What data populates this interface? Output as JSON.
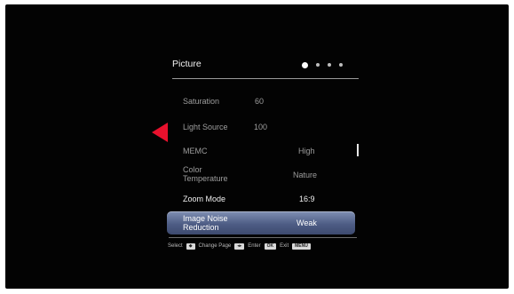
{
  "menu": {
    "title": "Picture",
    "page_dots": [
      {
        "active": true
      },
      {
        "active": false
      },
      {
        "active": false
      },
      {
        "active": false
      }
    ],
    "items": [
      {
        "label": "Saturation",
        "value": "60"
      },
      {
        "label": "Light Source",
        "value": "100"
      },
      {
        "label": "MEMC",
        "value": "High"
      },
      {
        "label": "Color\nTemperature",
        "value": "Nature"
      },
      {
        "label": "Zoom Mode",
        "value": "16:9"
      },
      {
        "label": "Image Noise\nReduction",
        "value": "Weak"
      }
    ]
  },
  "hints": {
    "select_label": "Select",
    "select_key": "◆",
    "change_page_label": "Change Page",
    "change_page_key": "◂▸",
    "enter_label": "Enter",
    "enter_key": "OK",
    "exit_label": "Exit",
    "exit_key": "MENU"
  },
  "colors": {
    "background": "#030303",
    "highlight": "#5a6a92",
    "arrow": "#e8112d"
  }
}
